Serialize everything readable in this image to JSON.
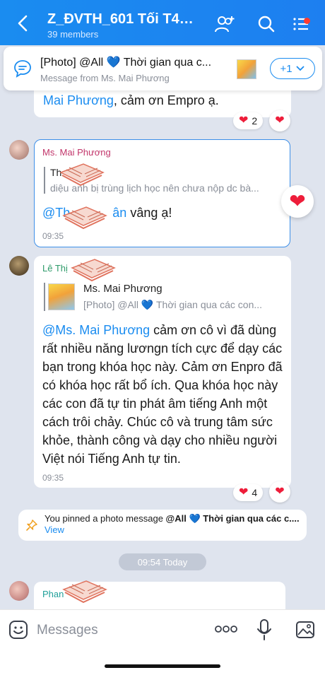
{
  "header": {
    "title": "Z_ĐVTH_601 Tối T4+...",
    "members": "39 members"
  },
  "pinned_banner": {
    "title": "[Photo] @All 💙 Thời gian qua c...",
    "from": "Message from Ms. Mai Phương",
    "more_label": "+1"
  },
  "messages": [
    {
      "mention": "Mai Phương",
      "text": ", cảm ơn Empro ạ.",
      "reaction_count": "2"
    },
    {
      "sender": "Ms. Mai Phương",
      "quote_name": "Th",
      "quote_text": "diệu anh bị trùng lịch học nên chưa nộp dc bà...",
      "mention": "@Th",
      "mention_tail": "ân",
      "text": " vâng ạ!",
      "time": "09:35"
    },
    {
      "sender": "Lê Thị",
      "quote_name": "Ms. Mai Phương",
      "quote_text": "[Photo] @All 💙 Thời gian qua các con...",
      "mention": "@Ms. Mai Phương",
      "text": " cảm ơn cô vì đã dùng rất nhiều năng lươngn tích cực để dạy các bạn trong khóa học này. Cảm ơn Enpro đã có khóa học rất bổ ích. Qua khóa học này các con đã tự tin phát âm tiếng Anh một cách trôi chảy. Chúc cô và trung tâm sức khỏe, thành công và dạy cho nhiều người Việt nói Tiếng Anh tự tin.",
      "time": "09:35",
      "reaction_count": "4"
    },
    {
      "sender": "Phan"
    }
  ],
  "pin_notice": {
    "prefix": "You pinned a photo message ",
    "bold": "@All 💙 Thời gian qua các c....",
    "link": " View"
  },
  "time_divider": "09:54 Today",
  "input": {
    "placeholder": "Messages"
  },
  "colors": {
    "primary": "#1a8cf0",
    "heart": "#ee1d3a",
    "chat_bg": "#dfe4ee"
  }
}
